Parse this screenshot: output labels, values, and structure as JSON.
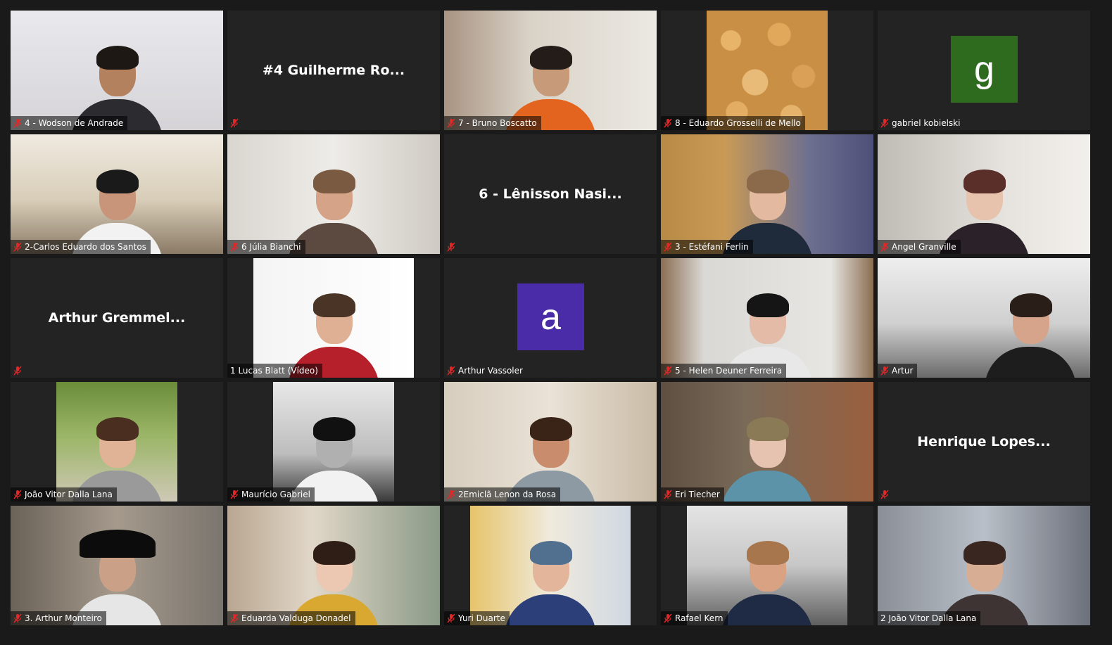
{
  "colors": {
    "background": "#1a1a1a",
    "tile_background": "#232323",
    "muted_mic": "#e02828",
    "avatar_g": "#2e6b1f",
    "avatar_a": "#4b2ca8"
  },
  "participants": [
    {
      "label": "4 - Wodson de Andrade",
      "mode": "video",
      "muted": true
    },
    {
      "label": "",
      "display_name": "#4 Guilherme Ro...",
      "mode": "name",
      "muted": true
    },
    {
      "label": "7 - Bruno Boscatto",
      "mode": "video",
      "muted": true
    },
    {
      "label": "8 - Eduardo Grosselli de Mello",
      "mode": "video",
      "muted": true
    },
    {
      "label": "gabriel kobielski",
      "avatar_letter": "g",
      "mode": "avatar",
      "muted": true
    },
    {
      "label": "2-Carlos Eduardo dos Santos",
      "mode": "video",
      "muted": true
    },
    {
      "label": "6 Júlia Bianchi",
      "mode": "video",
      "muted": true
    },
    {
      "label": "",
      "display_name": "6 - Lênisson Nasi...",
      "mode": "name",
      "muted": true
    },
    {
      "label": "3 - Estéfani Ferlin",
      "mode": "video",
      "muted": true
    },
    {
      "label": "Angel Granville",
      "mode": "video",
      "muted": true
    },
    {
      "label": "",
      "display_name": "Arthur Gremmel...",
      "mode": "name",
      "muted": true
    },
    {
      "label": "1 Lucas Blatt (Vídeo)",
      "mode": "video",
      "muted": false
    },
    {
      "label": "Arthur Vassoler",
      "avatar_letter": "a",
      "mode": "avatar",
      "muted": true
    },
    {
      "label": "5 - Helen Deuner Ferreira",
      "mode": "video",
      "muted": true
    },
    {
      "label": "Artur",
      "mode": "video",
      "muted": true
    },
    {
      "label": "João Vitor Dalla Lana",
      "mode": "video",
      "muted": true
    },
    {
      "label": "Maurício Gabriel",
      "mode": "video",
      "muted": true
    },
    {
      "label": "2Emiclã Lenon da Rosa",
      "mode": "video",
      "muted": true
    },
    {
      "label": "Eri Tiecher",
      "mode": "video",
      "muted": true
    },
    {
      "label": "",
      "display_name": "Henrique Lopes...",
      "mode": "name",
      "muted": true
    },
    {
      "label": "3. Arthur Monteiro",
      "mode": "video",
      "muted": true
    },
    {
      "label": "Eduarda Valduga Donadel",
      "mode": "video",
      "muted": true
    },
    {
      "label": "Yuri Duarte",
      "mode": "video",
      "muted": true
    },
    {
      "label": "Rafael Kern",
      "mode": "video",
      "muted": true
    },
    {
      "label": "2 João Vitor Dalla Lana",
      "mode": "video",
      "muted": false
    }
  ]
}
